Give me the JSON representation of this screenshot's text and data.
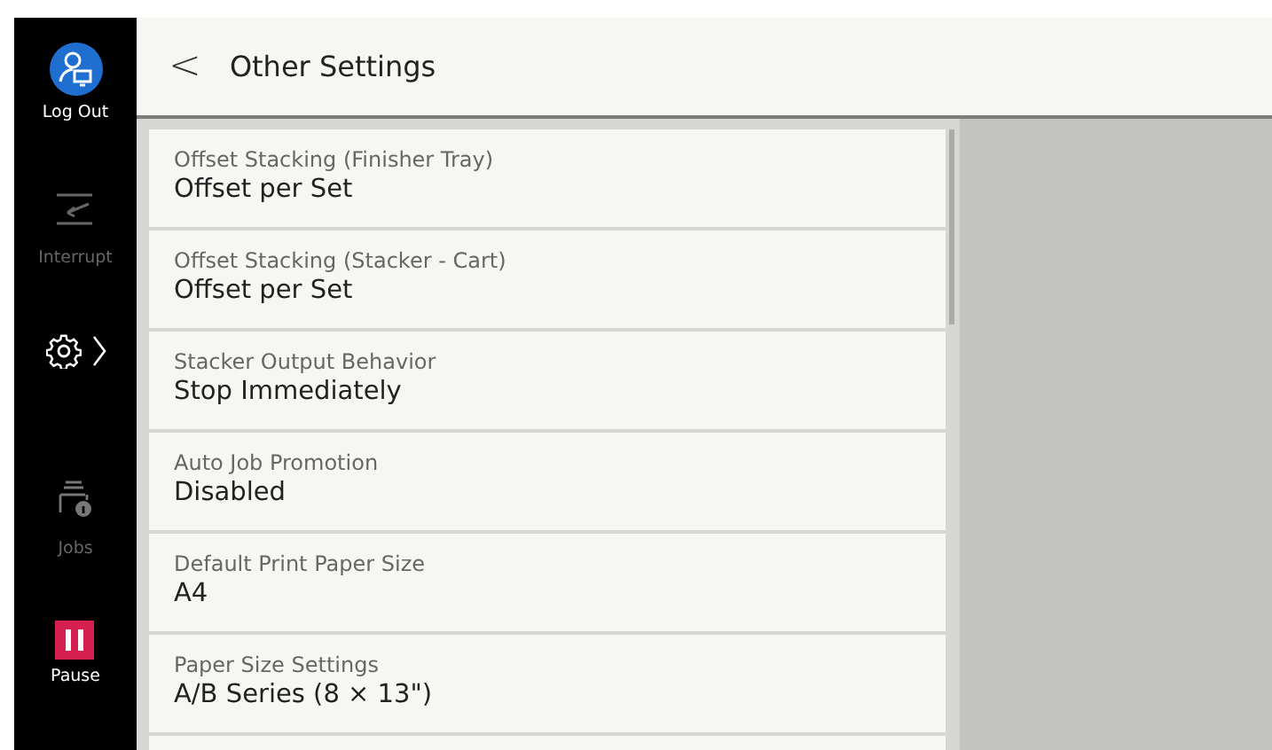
{
  "sidebar": {
    "items": [
      {
        "kind": "logout",
        "label": "Log Out",
        "disabled": false
      },
      {
        "kind": "interrupt",
        "label": "Interrupt",
        "disabled": true
      },
      {
        "kind": "settings",
        "disabled": false
      },
      {
        "kind": "jobs",
        "label": "Jobs",
        "disabled": true
      },
      {
        "kind": "pause",
        "label": "Pause",
        "disabled": false
      }
    ]
  },
  "header": {
    "back": "<",
    "title": "Other Settings"
  },
  "settings": [
    {
      "label": "Offset Stacking (Finisher Tray)",
      "value": "Offset per Set"
    },
    {
      "label": "Offset Stacking (Stacker - Cart)",
      "value": "Offset per Set"
    },
    {
      "label": "Stacker Output Behavior",
      "value": "Stop Immediately"
    },
    {
      "label": "Auto Job Promotion",
      "value": "Disabled"
    },
    {
      "label": "Default Print Paper Size",
      "value": "A4"
    },
    {
      "label": "Paper Size Settings",
      "value": "A/B Series (8 × 13\")"
    }
  ]
}
